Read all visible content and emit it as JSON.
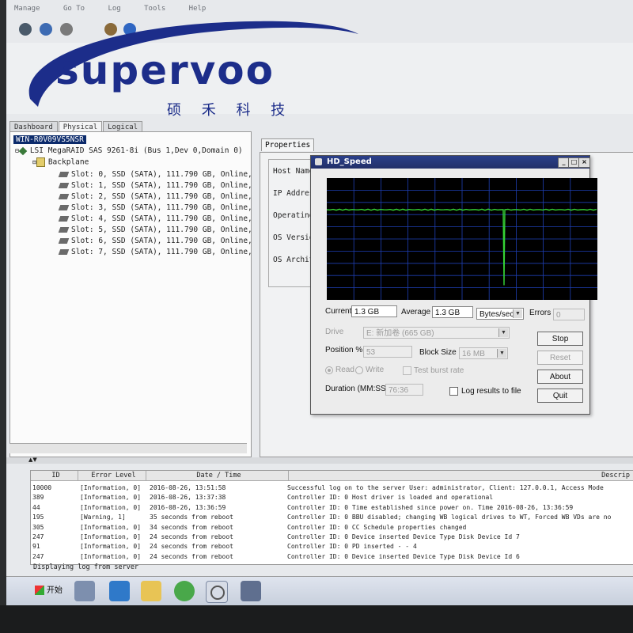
{
  "menu": {
    "items": [
      "Manage",
      "Go To",
      "Log",
      "Tools",
      "Help"
    ]
  },
  "logo": {
    "text": "supervoo",
    "chinese": "硕 禾 科 技",
    "color": "#1c2d8a"
  },
  "tabs": [
    "Dashboard",
    "Physical",
    "Logical"
  ],
  "tree": {
    "root": "WIN-R0V09VS5NSR",
    "controller": "LSI MegaRAID SAS 9261-8i (Bus 1,Dev 0,Domain 0)",
    "backplane": "Backplane",
    "slots": [
      "Slot: 0, SSD  (SATA), 111.790 GB, Online, (",
      "Slot: 1, SSD  (SATA), 111.790 GB, Online, (",
      "Slot: 2, SSD  (SATA), 111.790 GB, Online, (",
      "Slot: 3, SSD  (SATA), 111.790 GB, Online, (",
      "Slot: 4, SSD  (SATA), 111.790 GB, Online, (",
      "Slot: 5, SSD  (SATA), 111.790 GB, Online, (",
      "Slot: 6, SSD  (SATA), 111.790 GB, Online, (",
      "Slot: 7, SSD  (SATA), 111.790 GB, Online, ("
    ]
  },
  "properties": {
    "tab": "Properties",
    "labels": [
      "Host Name",
      "IP Address",
      "Operating S",
      "OS Version",
      "OS Archite"
    ]
  },
  "dialog": {
    "title": "HD_Speed",
    "current_label": "Current",
    "current_value": "1.3 GB",
    "average_label": "Average",
    "average_value": "1.3 GB",
    "unit": "Bytes/sec",
    "errors_label": "Errors",
    "errors_value": "0",
    "drive_label": "Drive",
    "drive_value": "E: 新加卷 (665 GB)",
    "position_label": "Position %",
    "position_value": "53",
    "blocksize_label": "Block Size",
    "blocksize_value": "16 MB",
    "read_label": "Read",
    "write_label": "Write",
    "testburst_label": "Test burst rate",
    "duration_label": "Duration (MM:SS)",
    "duration_value": "76:36",
    "log_label": "Log results to file",
    "buttons": {
      "stop": "Stop",
      "reset": "Reset",
      "about": "About",
      "quit": "Quit"
    },
    "graph": {
      "level": 0.74,
      "dip_position": 0.655,
      "dip_level": 0.12
    }
  },
  "log": {
    "headers": {
      "id": "ID",
      "level": "Error Level",
      "date": "Date / Time",
      "desc": "Descrip"
    },
    "rows": [
      {
        "id": "10000",
        "level": "[Information, 0]",
        "date": "2016-08-26, 13:51:58",
        "desc": "Successful log on to the server User:  administrator, Client:  127.0.0.1,    Access Mode"
      },
      {
        "id": "389",
        "level": "[Information, 0]",
        "date": "2016-08-26, 13:37:38",
        "desc": "Controller ID:  0   Host driver is loaded and operational"
      },
      {
        "id": "44",
        "level": "[Information, 0]",
        "date": "2016-08-26, 13:36:59",
        "desc": "Controller ID:  0   Time established since power on.   Time   2016-08-26, 13:36:59"
      },
      {
        "id": "195",
        "level": "[Warning, 1]",
        "date": "35  seconds from reboot",
        "desc": "Controller ID:  0   BBU disabled; changing WB logical drives to WT, Forced WB VDs are no"
      },
      {
        "id": "305",
        "level": "[Information, 0]",
        "date": "34  seconds from reboot",
        "desc": "Controller ID:  0   CC Schedule properties changed"
      },
      {
        "id": "247",
        "level": "[Information, 0]",
        "date": "24  seconds from reboot",
        "desc": "Controller ID:  0   Device inserted   Device Type        Disk  Device Id    7"
      },
      {
        "id": "91",
        "level": "[Information, 0]",
        "date": "24  seconds from reboot",
        "desc": "Controller ID:  0   PD inserted        - - 4"
      },
      {
        "id": "247",
        "level": "[Information, 0]",
        "date": "24  seconds from reboot",
        "desc": "Controller ID:  0   Device inserted   Device Type        Disk  Device Id    6"
      }
    ],
    "status": "Displaying log from server"
  },
  "taskbar": {
    "start": "开始"
  }
}
